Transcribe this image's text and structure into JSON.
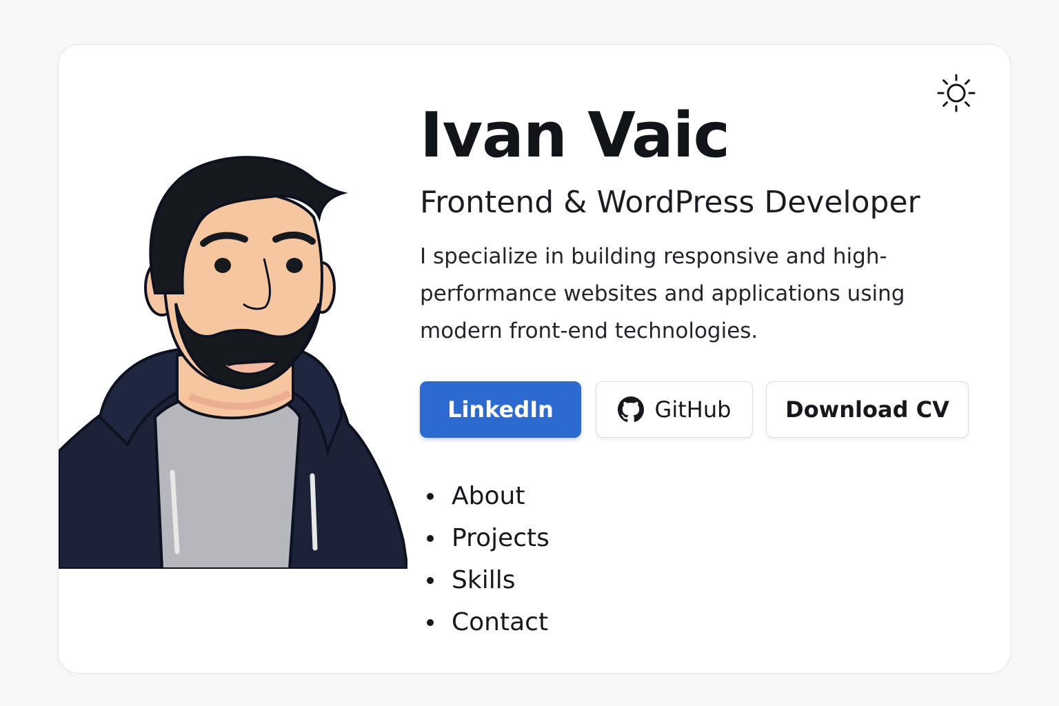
{
  "profile": {
    "name": "Ivan Vaic",
    "role": "Frontend & WordPress Developer",
    "bio": "I specialize in building responsive and high-performance websites and applications using modern front-end technologies."
  },
  "buttons": {
    "linkedin": "LinkedIn",
    "github": "GitHub",
    "cv": "Download CV"
  },
  "nav": {
    "items": [
      "About",
      "Projects",
      "Skills",
      "Contact"
    ]
  },
  "icons": {
    "theme_toggle": "sun-icon",
    "github": "github-icon"
  },
  "colors": {
    "accent": "#2d6acf",
    "text": "#111418",
    "card_background": "#ffffff",
    "page_background": "#f7f8fa"
  }
}
